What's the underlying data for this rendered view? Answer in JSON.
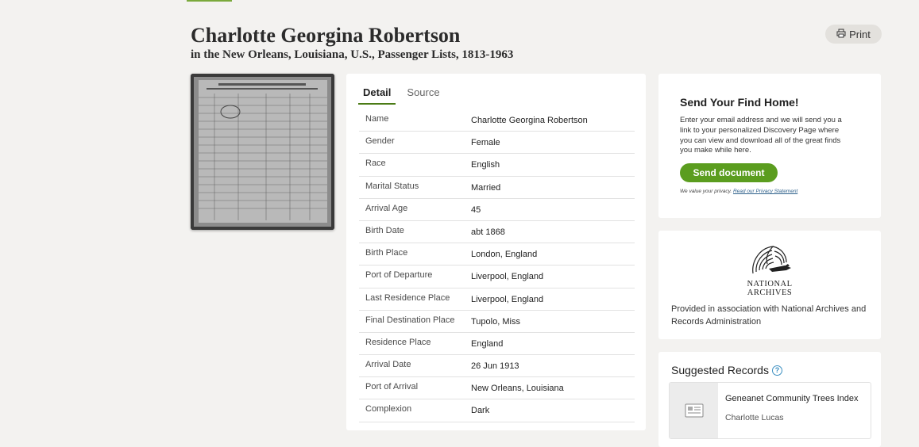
{
  "header": {
    "title": "Charlotte Georgina Robertson",
    "subtitle": "in the New Orleans, Louisiana, U.S., Passenger Lists, 1813-1963",
    "print_label": "Print"
  },
  "tabs": [
    {
      "label": "Detail"
    },
    {
      "label": "Source"
    }
  ],
  "details": [
    {
      "key": "Name",
      "value": "Charlotte Georgina Robertson"
    },
    {
      "key": "Gender",
      "value": "Female"
    },
    {
      "key": "Race",
      "value": "English"
    },
    {
      "key": "Marital Status",
      "value": "Married"
    },
    {
      "key": "Arrival Age",
      "value": "45"
    },
    {
      "key": "Birth Date",
      "value": "abt 1868"
    },
    {
      "key": "Birth Place",
      "value": "London, England"
    },
    {
      "key": "Port of Departure",
      "value": "Liverpool, England"
    },
    {
      "key": "Last Residence Place",
      "value": "Liverpool, England"
    },
    {
      "key": "Final Destination Place",
      "value": "Tupolo, Miss"
    },
    {
      "key": "Residence Place",
      "value": "England"
    },
    {
      "key": "Arrival Date",
      "value": "26 Jun 1913"
    },
    {
      "key": "Port of Arrival",
      "value": "New Orleans, Louisiana"
    },
    {
      "key": "Complexion",
      "value": "Dark"
    }
  ],
  "find_home": {
    "title": "Send Your Find Home!",
    "body": "Enter your email address and we will send you a link to your personalized Discovery Page where you can view and download all of the great finds you make while here.",
    "button": "Send document",
    "privacy_text": "We value your privacy.",
    "privacy_link": "Read our Privacy Statement"
  },
  "archives": {
    "logo_line1": "NATIONAL",
    "logo_line2": "ARCHIVES",
    "description": "Provided in association with National Archives and Records Administration"
  },
  "suggested": {
    "title": "Suggested Records",
    "items": [
      {
        "title": "Geneanet Community Trees Index",
        "subtitle": "Charlotte Lucas"
      }
    ]
  },
  "colors": {
    "accent_green": "#5b9d1f",
    "tab_underline": "#4b7b16",
    "background": "#f3f2f0",
    "link_blue": "#2c5f8a"
  },
  "icons": [
    "print-icon",
    "help-icon",
    "document-icon",
    "eagle-logo-icon"
  ]
}
